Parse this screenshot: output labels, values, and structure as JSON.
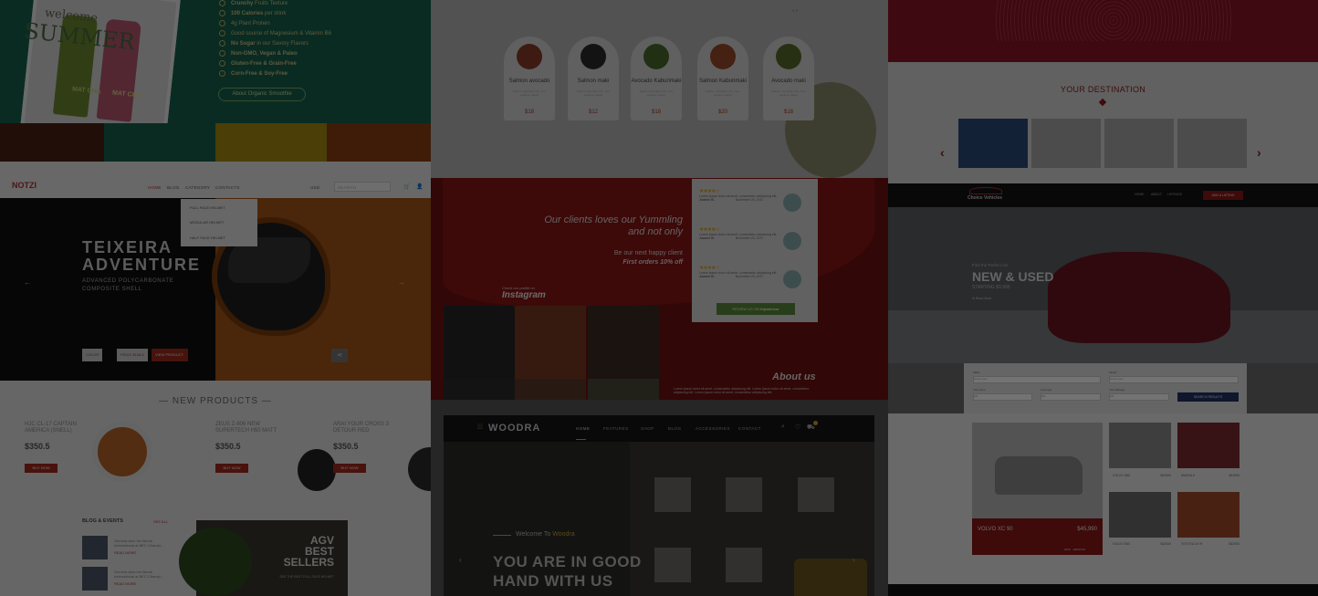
{
  "col1": {
    "welcome": "welcome",
    "summer": "SUMMER",
    "bottle1": "MAT CHA",
    "bottle2": "MAT CHA",
    "features": [
      {
        "b": "Crunchy",
        "t": " Fruits Texture"
      },
      {
        "b": "100 Calories",
        "t": " per drink"
      },
      {
        "b": "",
        "t": "4g Plant Protein"
      },
      {
        "b": "",
        "t": "Good source of Magnesium & Vitamin B6"
      },
      {
        "b": "No Sugar",
        "t": " in our Savory Flavors"
      },
      {
        "b": "Non-GMO, Vegan & Paleo",
        "t": ""
      },
      {
        "b": "Gluten-Free & Grain-Free",
        "t": ""
      },
      {
        "b": "Corn-Free & Soy-Free",
        "t": ""
      }
    ],
    "about_btn": "About Organic Smoothie",
    "logo": "NOTZI",
    "nav": [
      "HOME",
      "BLOG",
      "CATEGORY",
      "CONTACTS"
    ],
    "lang": "USD",
    "search_placeholder": "SEARCH",
    "dropdown": [
      "FULL FACE HELMET",
      "MODULAR HELMET",
      "HALF FACE HELMET"
    ],
    "hero_title_1": "TEIXEIRA",
    "hero_title_2": "ADVENTURE",
    "hero_sub_1": "ADVANCED POLYCARBONATE",
    "hero_sub_2": "COMPOSITE SHELL",
    "color_lbl": "COLOR",
    "price_lbl": "PRICE",
    "price_val": "$128.8",
    "view_btn": "VIEW PRODUCT",
    "new_products": "NEW PRODUCTS",
    "products": [
      {
        "name": "HJC CL-17 CAPTAIN AMERICA (SNELL)",
        "price": "$350.5",
        "buy": "BUY NOW"
      },
      {
        "name": "ZEUS Z-806 NEW SUPERTECH H50 MATT",
        "price": "$350.5",
        "buy": "BUY NOW"
      },
      {
        "name": "ARAI YOUR CROSS 3 DETOUR RED",
        "price": "$350.5",
        "buy": "BUY NOW"
      }
    ],
    "blog_title": "BLOG & EVENTS",
    "blog_more": "SEE ALL",
    "blog_items": [
      {
        "t1": "Gemma wins her Burah",
        "t2": "International at BEC Champi...",
        "more": "READ MORE"
      },
      {
        "t1": "Gemma wins her Burah",
        "t2": "International at BEC Champi...",
        "more": "READ MORE"
      }
    ],
    "agv": [
      "AGV",
      "BEST",
      "SELLERS"
    ],
    "agv_small": "SEE THE BEST FULL FACE HELMET"
  },
  "col2": {
    "sushi": [
      {
        "name": "Salmon avocado",
        "price": "$18"
      },
      {
        "name": "Salmon maki",
        "price": "$12"
      },
      {
        "name": "Avocado Kaburimaki",
        "price": "$18"
      },
      {
        "name": "Salmon Kaburimaki",
        "price": "$20"
      },
      {
        "name": "Avocado maki",
        "price": "$18"
      }
    ],
    "sushi_desc": "Salmon, avocado, rice, nori, sesame, sauce",
    "clients_1": "Our clients loves our Yummling",
    "clients_2": "and not only",
    "happy_1": "Be our next happy client",
    "happy_2": "First orders 10% off",
    "insta_small": "Check our profile on",
    "insta": "Instagram",
    "reviews": [
      {
        "name": "Joanne B.",
        "date": "November 23, 2017",
        "text": "Lorem ipsum dolor sit amet, consectetur adipiscing elit."
      },
      {
        "name": "Joanne B.",
        "date": "November 23, 2017",
        "text": "Lorem ipsum dolor sit amet, consectetur adipiscing elit."
      },
      {
        "name": "Joanne B.",
        "date": "November 23, 2017",
        "text": "Lorem ipsum dolor sit amet, consectetur adipiscing elit."
      }
    ],
    "stars": "★★★★☆",
    "trip_small": "REVIEW US ON",
    "trip": "tripadvisor",
    "about_us": "About us",
    "about_text": "Lorem ipsum dolor sit amet, consectetur adipiscing elit. Lorem ipsum dolor sit amet, consectetur adipiscing elit. Lorem ipsum dolor sit amet, consectetur adipiscing elit.",
    "woodra": "WOODRA",
    "woodra_nav": [
      "HOME",
      "FEATURES",
      "SHOP",
      "BLOG",
      "ACCESSORIES",
      "CONTACT"
    ],
    "welcome_to": "Welcome To ",
    "welcome_brand": "Woodra",
    "good_1": "YOU ARE IN GOOD",
    "good_2": "HAND WITH US"
  },
  "col3": {
    "destination": "YOUR DESTINATION",
    "cv_logo": "Choice Vehicles",
    "car_nav": [
      "HOME",
      "ABOUT",
      "LISTINGS"
    ],
    "car_btn": "ADD A LISTING",
    "find": "Find the Perfect car",
    "new_used": "NEW & USED",
    "starting": "STARTING $9,999",
    "read_more": "Read More",
    "form_labels": [
      "Make",
      "Model",
      "Year price",
      "Fuel type",
      "Year Mileage"
    ],
    "form_placeholders": [
      "Select type",
      "Select type",
      "Min",
      "Min",
      "Min"
    ],
    "search_btn": "SEARCH RESULTS",
    "big_car": "VOLVO XC 90",
    "big_price": "$45,990",
    "big_meta_1": "2016",
    "big_meta_2": "12000 KM",
    "small_cars": [
      {
        "name": "VOLVO S60",
        "price": "$32000"
      },
      {
        "name": "MAZDA 6",
        "price": "$32000"
      },
      {
        "name": "VOLVO S60",
        "price": "$32000"
      },
      {
        "name": "TOYOTA CH R",
        "price": "$32000"
      }
    ]
  }
}
